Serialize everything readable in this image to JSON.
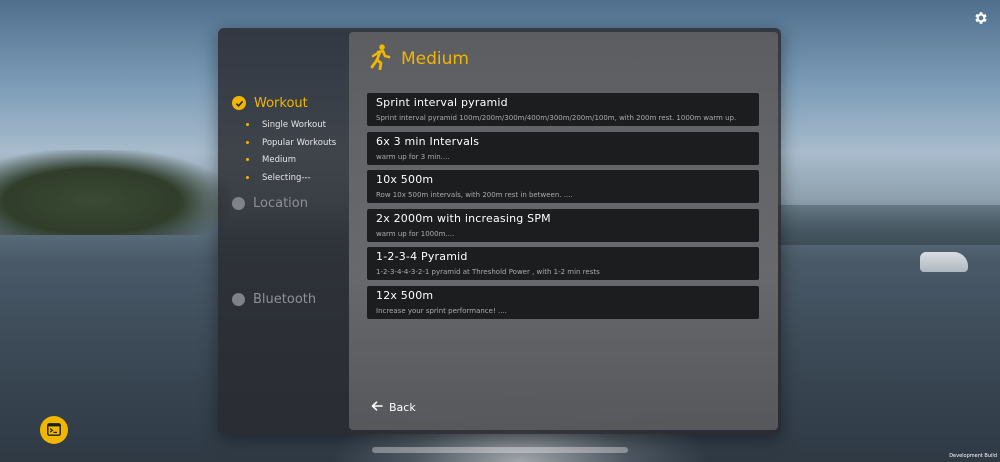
{
  "nav": {
    "steps": [
      {
        "label": "Workout",
        "status": "done"
      },
      {
        "label": "Location",
        "status": "pending"
      },
      {
        "label": "Bluetooth",
        "status": "pending"
      }
    ],
    "workout_substeps": [
      "Single Workout",
      "Popular Workouts",
      "Medium",
      "Selecting---"
    ]
  },
  "content": {
    "title": "Medium",
    "icon": "running-person-icon"
  },
  "workouts": [
    {
      "title": "Sprint interval pyramid",
      "desc": "Sprint interval pyramid 100m/200m/300m/400m/300m/200m/100m, with 200m rest. 1000m warm up."
    },
    {
      "title": "6x 3 min Intervals",
      "desc": "warm up for 3 min...."
    },
    {
      "title": "10x 500m",
      "desc": "Row 10x 500m intervals, with 200m rest in between. ...."
    },
    {
      "title": "2x 2000m with increasing SPM",
      "desc": "warm up for 1000m...."
    },
    {
      "title": "1-2-3-4 Pyramid",
      "desc": "1-2-3-4-4-3-2-1 pyramid at Threshold Power , with 1-2 min rests"
    },
    {
      "title": "12x 500m",
      "desc": "Increase your sprint performance! ...."
    }
  ],
  "back_label": "Back",
  "footer": {
    "dev_build": "Development Build"
  },
  "colors": {
    "accent": "#f1b600",
    "card": "#1c1d1f"
  }
}
